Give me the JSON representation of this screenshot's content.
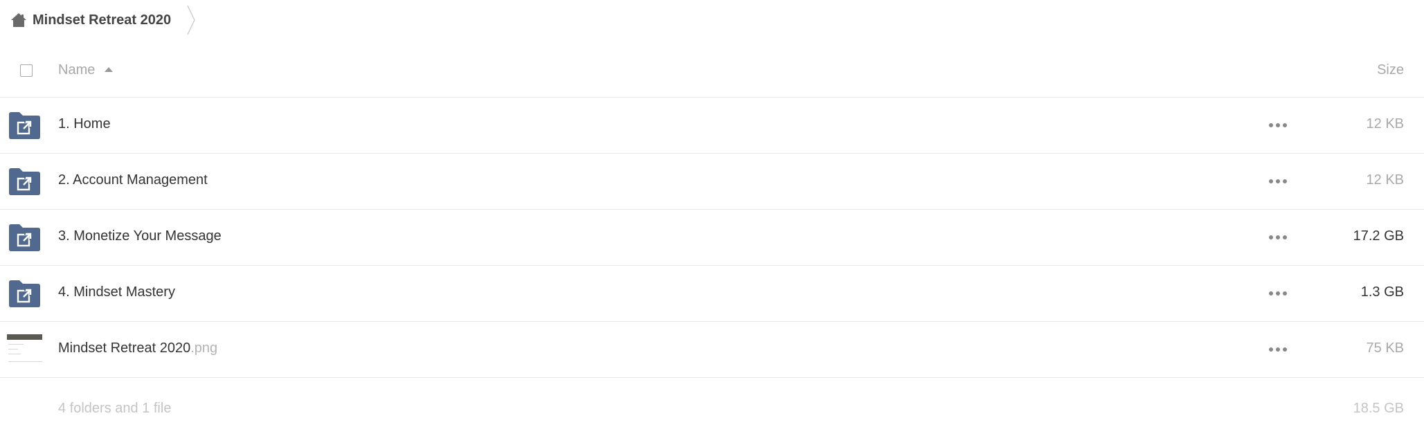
{
  "breadcrumb": {
    "home_icon": "home-icon",
    "current": "Mindset Retreat 2020",
    "separator_icon": "chevron-right-icon"
  },
  "header": {
    "select_all_icon": "checkbox-icon",
    "name_label": "Name",
    "sort_icon": "sort-ascending-icon",
    "size_label": "Size"
  },
  "rows": [
    {
      "name": "1. Home",
      "ext": "",
      "size": "12 KB",
      "type": "shared-folder",
      "icon": "shared-folder-icon",
      "menu_icon": "more-options-icon"
    },
    {
      "name": "2. Account Management",
      "ext": "",
      "size": "12 KB",
      "type": "shared-folder",
      "icon": "shared-folder-icon",
      "menu_icon": "more-options-icon"
    },
    {
      "name": "3. Monetize Your Message",
      "ext": "",
      "size": "17.2 GB",
      "type": "shared-folder",
      "icon": "shared-folder-icon",
      "menu_icon": "more-options-icon"
    },
    {
      "name": "4. Mindset Mastery",
      "ext": "",
      "size": "1.3 GB",
      "type": "shared-folder",
      "icon": "shared-folder-icon",
      "menu_icon": "more-options-icon"
    },
    {
      "name": "Mindset Retreat 2020",
      "ext": ".png",
      "size": "75 KB",
      "type": "image",
      "icon": "image-thumbnail",
      "menu_icon": "more-options-icon"
    }
  ],
  "summary": {
    "text": "4 folders and 1 file",
    "total_size": "18.5 GB"
  },
  "colors": {
    "folder": "#51698f",
    "muted_text": "#a8a8a8",
    "divider": "#e8e8e8"
  }
}
